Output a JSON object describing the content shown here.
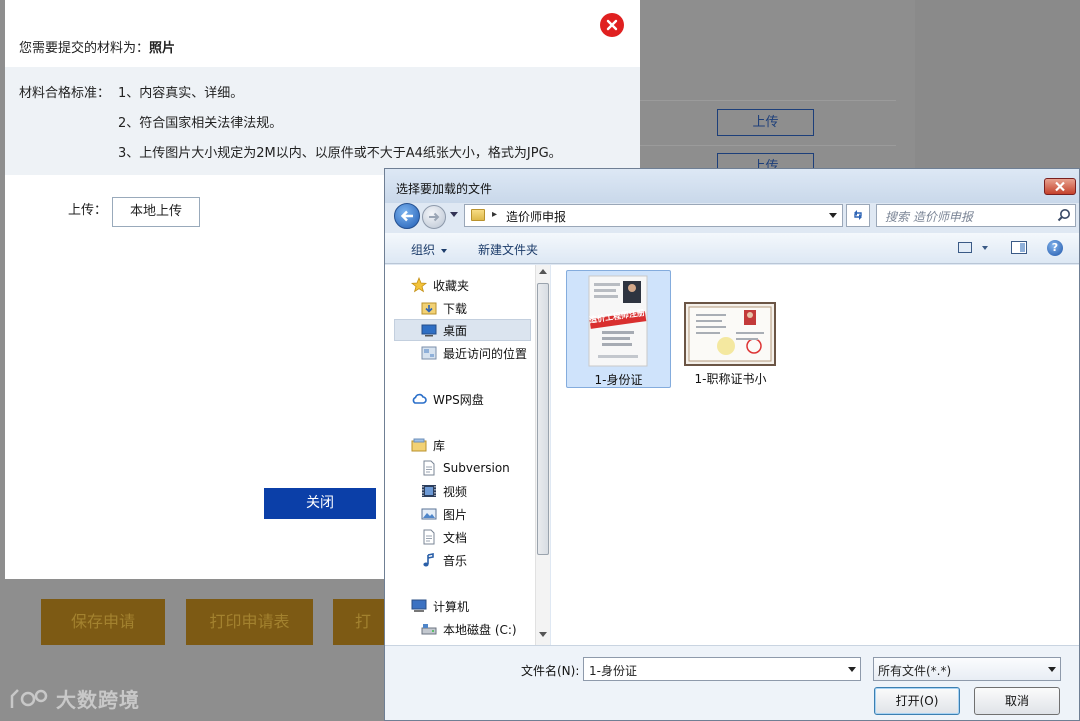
{
  "background": {
    "upload_buttons": [
      "上传",
      "上传"
    ],
    "action_buttons": [
      "保存申请",
      "打印申请表",
      "打印"
    ],
    "watermark": "大数跨境"
  },
  "material_dialog": {
    "title_prefix": "您需要提交的材料为：",
    "title_value": "照片",
    "standards_label": "材料合格标准：",
    "standards": [
      "1、内容真实、详细。",
      "2、符合国家相关法律法规。",
      "3、上传图片大小规定为2M以内、以原件或不大于A4纸张大小，格式为JPG。"
    ],
    "upload_label": "上传：",
    "local_upload_label": "本地上传",
    "close_label": "关闭"
  },
  "file_dialog": {
    "title": "选择要加载的文件",
    "address": "造价师申报",
    "search_placeholder": "搜索 造价师申报",
    "toolbar": {
      "organize": "组织",
      "new_folder": "新建文件夹"
    },
    "nav_items": [
      {
        "label": "收藏夹",
        "icon": "star-icon"
      },
      {
        "label": "下载",
        "icon": "download-folder-icon"
      },
      {
        "label": "桌面",
        "icon": "desktop-icon"
      },
      {
        "label": "最近访问的位置",
        "icon": "recent-places-icon"
      },
      {
        "label": "WPS网盘",
        "icon": "cloud-icon"
      },
      {
        "label": "库",
        "icon": "library-icon"
      },
      {
        "label": "Subversion",
        "icon": "document-icon"
      },
      {
        "label": "视频",
        "icon": "video-icon"
      },
      {
        "label": "图片",
        "icon": "picture-icon"
      },
      {
        "label": "文档",
        "icon": "document-icon"
      },
      {
        "label": "音乐",
        "icon": "music-icon"
      },
      {
        "label": "计算机",
        "icon": "computer-icon"
      },
      {
        "label": "本地磁盘 (C:)",
        "icon": "disk-icon"
      }
    ],
    "files": [
      {
        "name": "1-身份证",
        "stamp": "造价工程师注册"
      },
      {
        "name": "1-职称证书小"
      }
    ],
    "filename_label": "文件名(N):",
    "filename_value": "1-身份证",
    "filetype_value": "所有文件(*.*)",
    "open_label": "打开(O)",
    "cancel_label": "取消"
  }
}
